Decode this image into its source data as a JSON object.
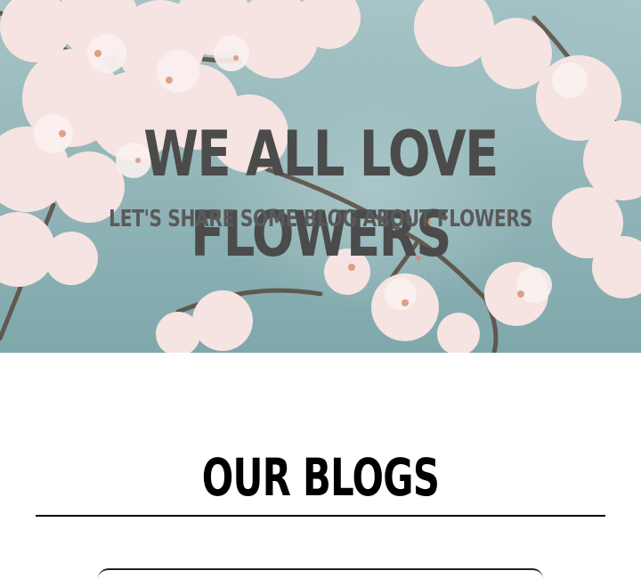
{
  "hero": {
    "title": "WE ALL LOVE FLOWERS",
    "subtitle": "LET'S SHARE SOME BLOG ABOUT FLOWERS",
    "background_image": "cherry-blossom-branches"
  },
  "blogs": {
    "heading": "OUR BLOGS"
  },
  "colors": {
    "title_text": "#4b4b4b",
    "subtitle_text": "#5a5a5a",
    "heading_text": "#000000",
    "sky": "#9fbfc1",
    "blossom": "#f6e4e2",
    "blossom_center": "#d98c6b",
    "branch": "#5a4a3e"
  }
}
